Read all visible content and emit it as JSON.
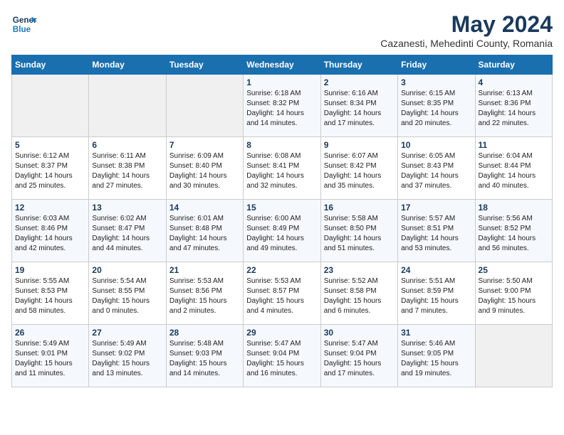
{
  "header": {
    "logo_line1": "General",
    "logo_line2": "Blue",
    "title": "May 2024",
    "subtitle": "Cazanesti, Mehedinti County, Romania"
  },
  "weekdays": [
    "Sunday",
    "Monday",
    "Tuesday",
    "Wednesday",
    "Thursday",
    "Friday",
    "Saturday"
  ],
  "weeks": [
    [
      {
        "day": "",
        "info": ""
      },
      {
        "day": "",
        "info": ""
      },
      {
        "day": "",
        "info": ""
      },
      {
        "day": "1",
        "info": "Sunrise: 6:18 AM\nSunset: 8:32 PM\nDaylight: 14 hours\nand 14 minutes."
      },
      {
        "day": "2",
        "info": "Sunrise: 6:16 AM\nSunset: 8:34 PM\nDaylight: 14 hours\nand 17 minutes."
      },
      {
        "day": "3",
        "info": "Sunrise: 6:15 AM\nSunset: 8:35 PM\nDaylight: 14 hours\nand 20 minutes."
      },
      {
        "day": "4",
        "info": "Sunrise: 6:13 AM\nSunset: 8:36 PM\nDaylight: 14 hours\nand 22 minutes."
      }
    ],
    [
      {
        "day": "5",
        "info": "Sunrise: 6:12 AM\nSunset: 8:37 PM\nDaylight: 14 hours\nand 25 minutes."
      },
      {
        "day": "6",
        "info": "Sunrise: 6:11 AM\nSunset: 8:38 PM\nDaylight: 14 hours\nand 27 minutes."
      },
      {
        "day": "7",
        "info": "Sunrise: 6:09 AM\nSunset: 8:40 PM\nDaylight: 14 hours\nand 30 minutes."
      },
      {
        "day": "8",
        "info": "Sunrise: 6:08 AM\nSunset: 8:41 PM\nDaylight: 14 hours\nand 32 minutes."
      },
      {
        "day": "9",
        "info": "Sunrise: 6:07 AM\nSunset: 8:42 PM\nDaylight: 14 hours\nand 35 minutes."
      },
      {
        "day": "10",
        "info": "Sunrise: 6:05 AM\nSunset: 8:43 PM\nDaylight: 14 hours\nand 37 minutes."
      },
      {
        "day": "11",
        "info": "Sunrise: 6:04 AM\nSunset: 8:44 PM\nDaylight: 14 hours\nand 40 minutes."
      }
    ],
    [
      {
        "day": "12",
        "info": "Sunrise: 6:03 AM\nSunset: 8:46 PM\nDaylight: 14 hours\nand 42 minutes."
      },
      {
        "day": "13",
        "info": "Sunrise: 6:02 AM\nSunset: 8:47 PM\nDaylight: 14 hours\nand 44 minutes."
      },
      {
        "day": "14",
        "info": "Sunrise: 6:01 AM\nSunset: 8:48 PM\nDaylight: 14 hours\nand 47 minutes."
      },
      {
        "day": "15",
        "info": "Sunrise: 6:00 AM\nSunset: 8:49 PM\nDaylight: 14 hours\nand 49 minutes."
      },
      {
        "day": "16",
        "info": "Sunrise: 5:58 AM\nSunset: 8:50 PM\nDaylight: 14 hours\nand 51 minutes."
      },
      {
        "day": "17",
        "info": "Sunrise: 5:57 AM\nSunset: 8:51 PM\nDaylight: 14 hours\nand 53 minutes."
      },
      {
        "day": "18",
        "info": "Sunrise: 5:56 AM\nSunset: 8:52 PM\nDaylight: 14 hours\nand 56 minutes."
      }
    ],
    [
      {
        "day": "19",
        "info": "Sunrise: 5:55 AM\nSunset: 8:53 PM\nDaylight: 14 hours\nand 58 minutes."
      },
      {
        "day": "20",
        "info": "Sunrise: 5:54 AM\nSunset: 8:55 PM\nDaylight: 15 hours\nand 0 minutes."
      },
      {
        "day": "21",
        "info": "Sunrise: 5:53 AM\nSunset: 8:56 PM\nDaylight: 15 hours\nand 2 minutes."
      },
      {
        "day": "22",
        "info": "Sunrise: 5:53 AM\nSunset: 8:57 PM\nDaylight: 15 hours\nand 4 minutes."
      },
      {
        "day": "23",
        "info": "Sunrise: 5:52 AM\nSunset: 8:58 PM\nDaylight: 15 hours\nand 6 minutes."
      },
      {
        "day": "24",
        "info": "Sunrise: 5:51 AM\nSunset: 8:59 PM\nDaylight: 15 hours\nand 7 minutes."
      },
      {
        "day": "25",
        "info": "Sunrise: 5:50 AM\nSunset: 9:00 PM\nDaylight: 15 hours\nand 9 minutes."
      }
    ],
    [
      {
        "day": "26",
        "info": "Sunrise: 5:49 AM\nSunset: 9:01 PM\nDaylight: 15 hours\nand 11 minutes."
      },
      {
        "day": "27",
        "info": "Sunrise: 5:49 AM\nSunset: 9:02 PM\nDaylight: 15 hours\nand 13 minutes."
      },
      {
        "day": "28",
        "info": "Sunrise: 5:48 AM\nSunset: 9:03 PM\nDaylight: 15 hours\nand 14 minutes."
      },
      {
        "day": "29",
        "info": "Sunrise: 5:47 AM\nSunset: 9:04 PM\nDaylight: 15 hours\nand 16 minutes."
      },
      {
        "day": "30",
        "info": "Sunrise: 5:47 AM\nSunset: 9:04 PM\nDaylight: 15 hours\nand 17 minutes."
      },
      {
        "day": "31",
        "info": "Sunrise: 5:46 AM\nSunset: 9:05 PM\nDaylight: 15 hours\nand 19 minutes."
      },
      {
        "day": "",
        "info": ""
      }
    ]
  ]
}
